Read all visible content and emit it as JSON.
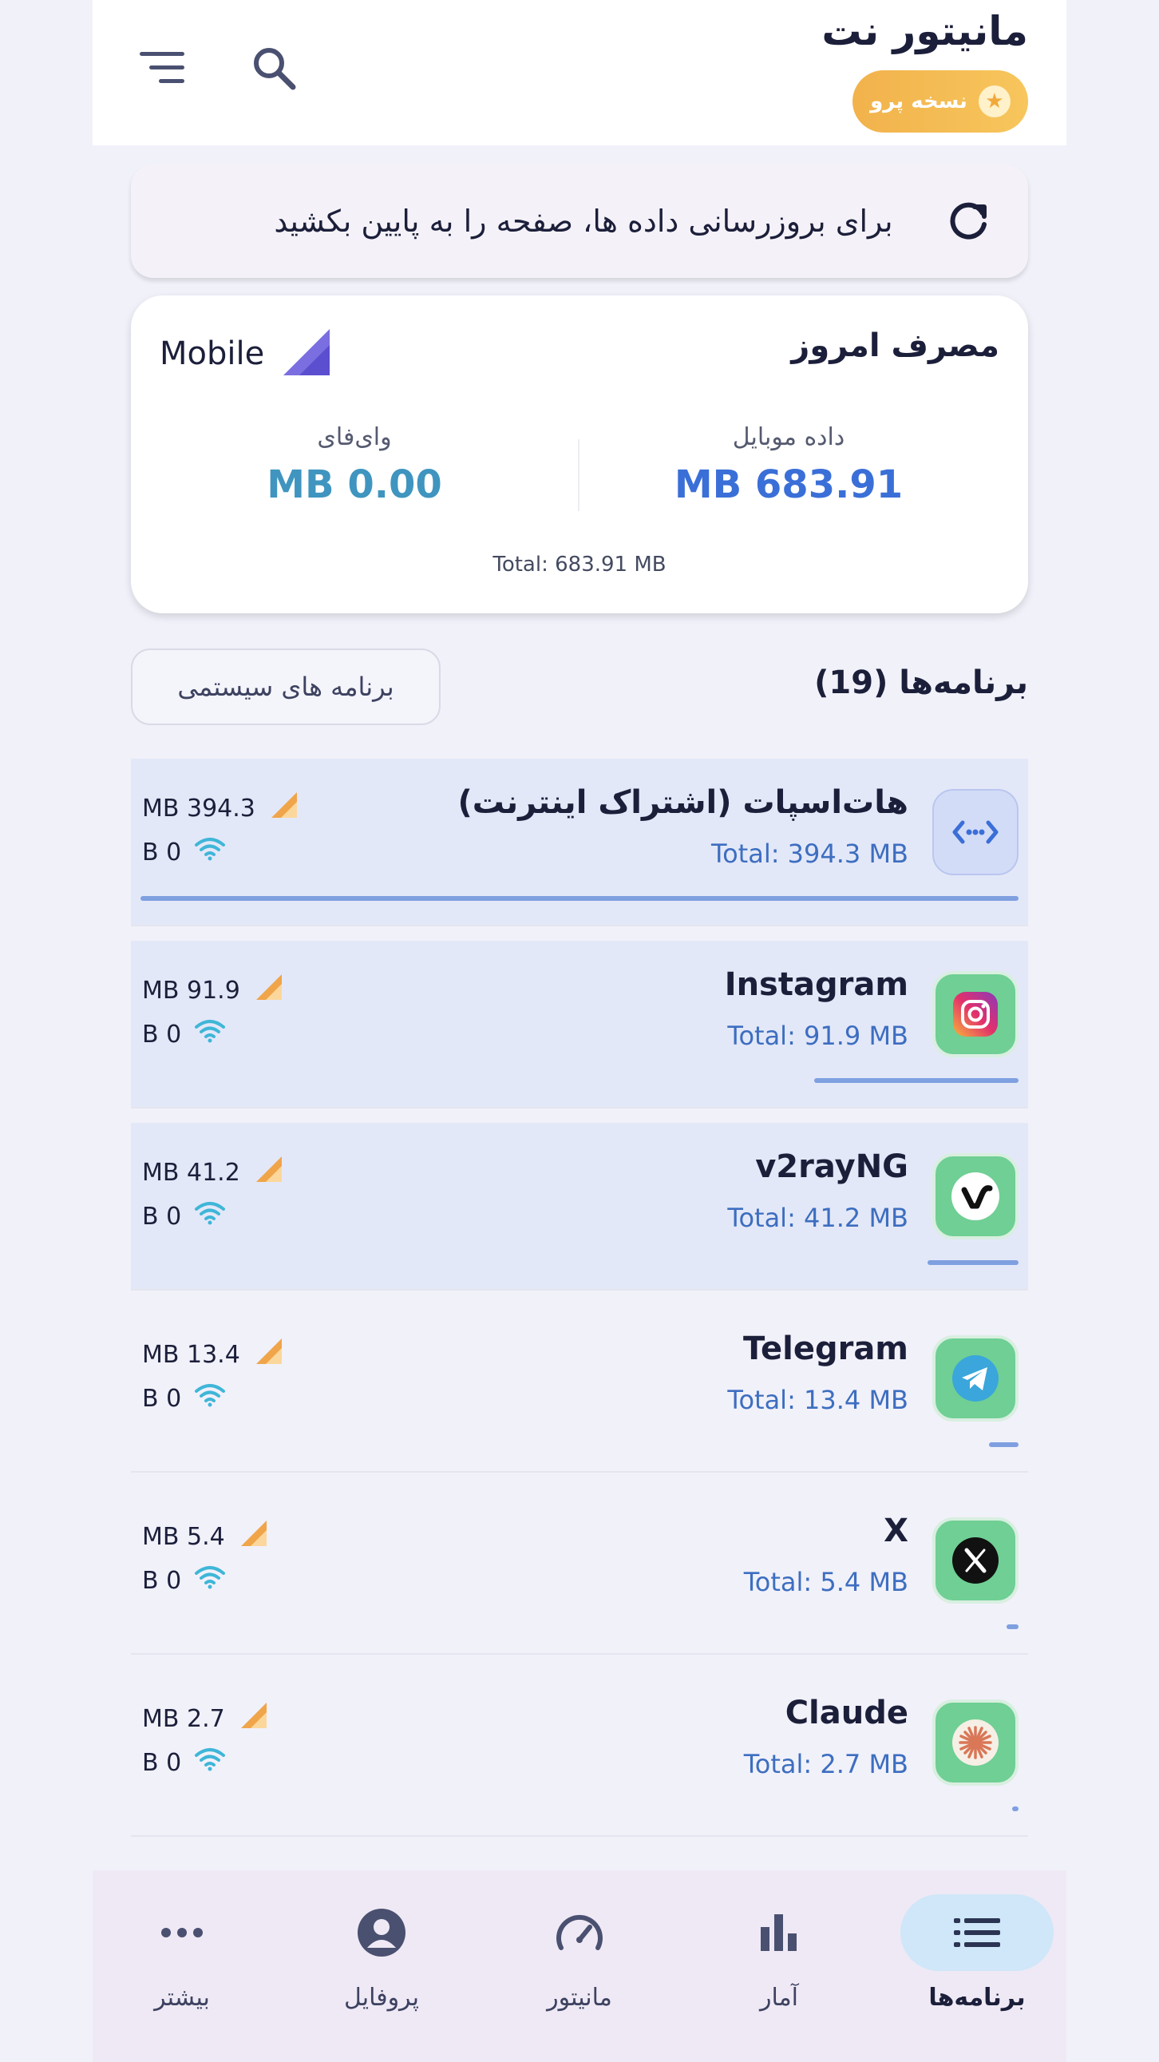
{
  "header": {
    "title": "مانیتور نت",
    "pro_label": "نسخه پرو"
  },
  "refresh": {
    "text": "برای بروزرسانی داده ها، صفحه را به پایین بکشید"
  },
  "usage": {
    "title": "مصرف امروز",
    "network_type": "Mobile",
    "mobile_label": "داده موبایل",
    "mobile_value": "MB 683.91",
    "wifi_label": "وای‌فای",
    "wifi_value": "MB 0.00",
    "total": "Total: 683.91 MB"
  },
  "apps": {
    "title": "برنامه‌ها (19)",
    "system_apps_button": "برنامه های سیستمی",
    "items": [
      {
        "name": "هات‌اسپات (اشتراک اینترنت)",
        "total": "Total: 394.3 MB",
        "mobile": "MB 394.3",
        "wifi": "B 0",
        "icon": "hotspot-icon",
        "share": 1.0
      },
      {
        "name": "Instagram",
        "total": "Total: 91.9 MB",
        "mobile": "MB 91.9",
        "wifi": "B 0",
        "icon": "instagram-icon",
        "share": 0.233
      },
      {
        "name": "v2rayNG",
        "total": "Total: 41.2 MB",
        "mobile": "MB 41.2",
        "wifi": "B 0",
        "icon": "v2rayng-icon",
        "share": 0.104
      },
      {
        "name": "Telegram",
        "total": "Total: 13.4 MB",
        "mobile": "MB 13.4",
        "wifi": "B 0",
        "icon": "telegram-icon",
        "share": 0.034
      },
      {
        "name": "X",
        "total": "Total: 5.4 MB",
        "mobile": "MB 5.4",
        "wifi": "B 0",
        "icon": "x-icon",
        "share": 0.014
      },
      {
        "name": "Claude",
        "total": "Total: 2.7 MB",
        "mobile": "MB 2.7",
        "wifi": "B 0",
        "icon": "claude-icon",
        "share": 0.007
      }
    ]
  },
  "nav": {
    "apps": "برنامه‌ها",
    "stats": "آمار",
    "monitor": "مانیتور",
    "profile": "پروفایل",
    "more": "بیشتر"
  },
  "colors": {
    "accent": "#3b6fd8",
    "pro_badge": "#f2b24c",
    "highlight_row": "#e3e8f8",
    "active_nav": "#cfe7f8"
  }
}
